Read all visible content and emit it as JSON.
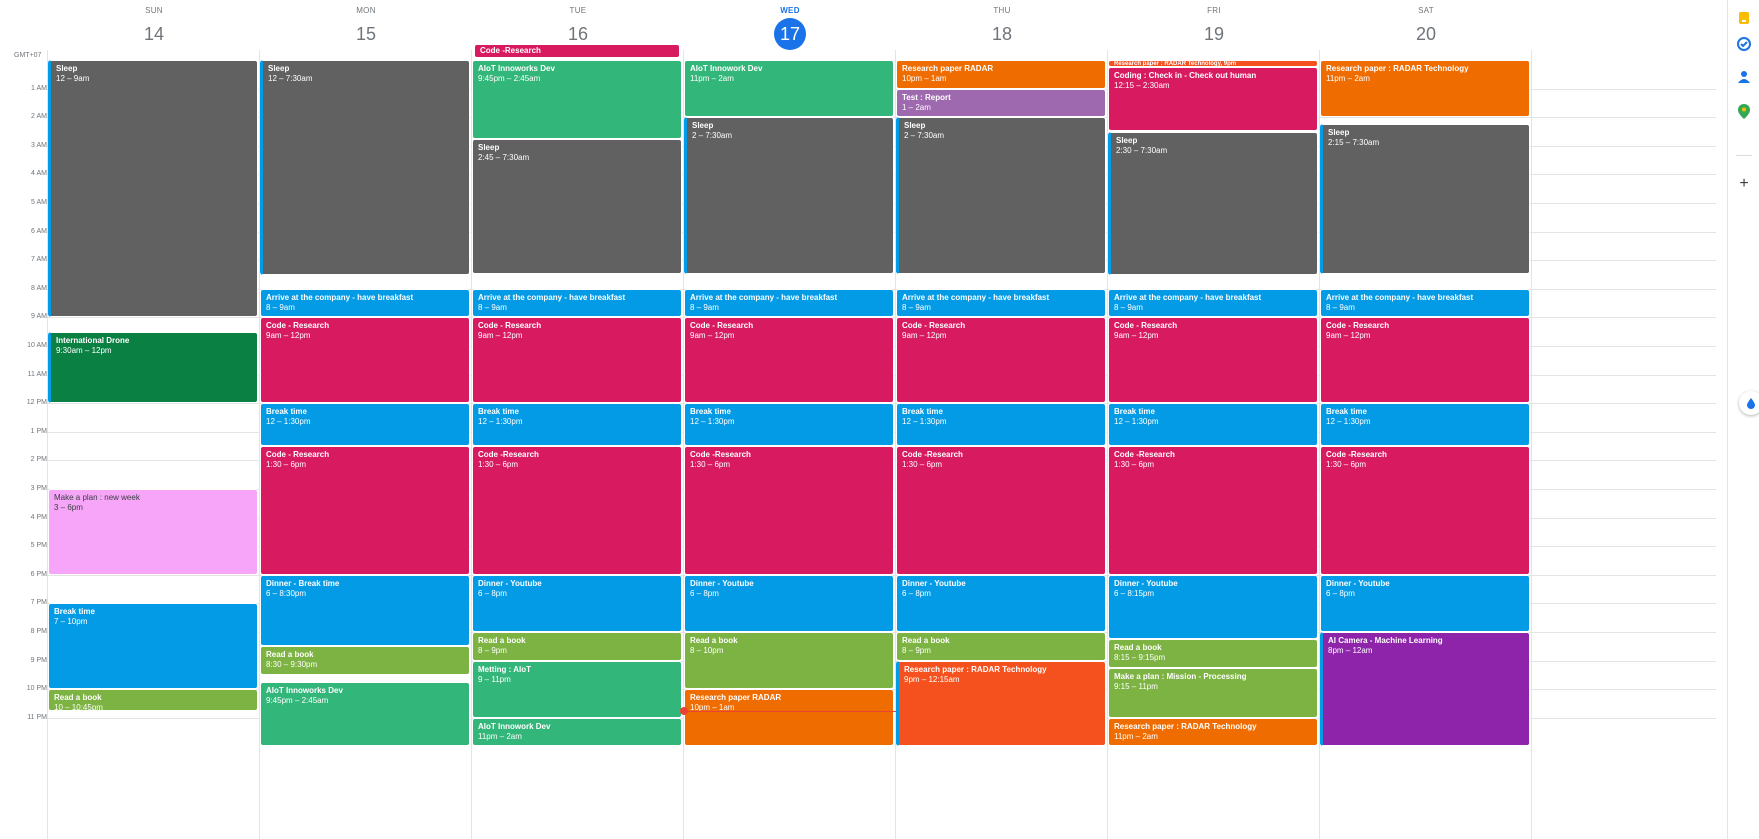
{
  "timezone": "GMT+07",
  "hours": [
    "1 AM",
    "2 AM",
    "3 AM",
    "4 AM",
    "5 AM",
    "6 AM",
    "7 AM",
    "8 AM",
    "9 AM",
    "10 AM",
    "11 AM",
    "12 PM",
    "1 PM",
    "2 PM",
    "3 PM",
    "4 PM",
    "5 PM",
    "6 PM",
    "7 PM",
    "8 PM",
    "9 PM",
    "10 PM",
    "11 PM"
  ],
  "colors": {
    "sleep": "#616161",
    "blue": "#039be5",
    "red": "#d81b60",
    "green": "#33b679",
    "darkgreen": "#0b8043",
    "olive": "#7cb342",
    "orange": "#ef6c00",
    "lavender": "#9e69af",
    "pink": "#f6a5f8",
    "tomato": "#f4511e",
    "purple": "#8e24aa",
    "today": "#1a73e8",
    "now": "#ea4335"
  },
  "days": [
    {
      "dow": "SUN",
      "date": "14",
      "today": false,
      "events": [
        {
          "title": "Sleep",
          "time": "12 – 9am",
          "color": "sleep",
          "start": 0,
          "end": 9,
          "ongoing": true
        },
        {
          "title": "International Drone",
          "time": "9:30am – 12pm",
          "color": "darkgreen",
          "start": 9.5,
          "end": 12,
          "ongoing": true
        },
        {
          "title": "Make a plan : new week",
          "time": "3 – 6pm",
          "color": "pink",
          "start": 15,
          "end": 18,
          "dark": true
        },
        {
          "title": "Break time",
          "time": "7 – 10pm",
          "color": "blue",
          "start": 19,
          "end": 22
        },
        {
          "title": "Read a book",
          "time": "10 – 10:45pm",
          "color": "olive",
          "start": 22,
          "end": 22.75
        }
      ]
    },
    {
      "dow": "MON",
      "date": "15",
      "today": false,
      "events": [
        {
          "title": "Sleep",
          "time": "12 – 7:30am",
          "color": "sleep",
          "start": 0,
          "end": 7.5,
          "ongoing": true
        },
        {
          "title": "Arrive at the company - have breakfast",
          "time": "8 – 9am",
          "color": "blue",
          "start": 8,
          "end": 9
        },
        {
          "title": "Code - Research",
          "time": "9am – 12pm",
          "color": "red",
          "start": 9,
          "end": 12
        },
        {
          "title": "Break time",
          "time": "12 – 1:30pm",
          "color": "blue",
          "start": 12,
          "end": 13.5
        },
        {
          "title": "Code - Research",
          "time": "1:30 – 6pm",
          "color": "red",
          "start": 13.5,
          "end": 18
        },
        {
          "title": "Dinner - Break time",
          "time": "6 – 8:30pm",
          "color": "blue",
          "start": 18,
          "end": 20.5
        },
        {
          "title": "Read a book",
          "time": "8:30 – 9:30pm",
          "color": "olive",
          "start": 20.5,
          "end": 21.5
        },
        {
          "title": "AIoT Innoworks Dev",
          "time": "9:45pm – 2:45am",
          "color": "green",
          "start": 21.75,
          "end": 24
        }
      ]
    },
    {
      "dow": "TUE",
      "date": "16",
      "today": false,
      "allday": {
        "title": "Code -Research",
        "color": "red"
      },
      "events": [
        {
          "title": "AIoT Innoworks Dev",
          "time": "9:45pm – 2:45am",
          "color": "green",
          "start": 0,
          "end": 2.75
        },
        {
          "title": "Sleep",
          "time": "2:45 – 7:30am",
          "color": "sleep",
          "start": 2.75,
          "end": 7.5
        },
        {
          "title": "Arrive at the company - have breakfast",
          "time": "8 – 9am",
          "color": "blue",
          "start": 8,
          "end": 9
        },
        {
          "title": "Code - Research",
          "time": "9am – 12pm",
          "color": "red",
          "start": 9,
          "end": 12
        },
        {
          "title": "Break time",
          "time": "12 – 1:30pm",
          "color": "blue",
          "start": 12,
          "end": 13.5
        },
        {
          "title": "Code -Research",
          "time": "1:30 – 6pm",
          "color": "red",
          "start": 13.5,
          "end": 18
        },
        {
          "title": "Dinner - Youtube",
          "time": "6 – 8pm",
          "color": "blue",
          "start": 18,
          "end": 20
        },
        {
          "title": "Read a book",
          "time": "8 – 9pm",
          "color": "olive",
          "start": 20,
          "end": 21
        },
        {
          "title": "Metting : AIoT",
          "time": "9 – 11pm",
          "color": "green",
          "start": 21,
          "end": 23
        },
        {
          "title": "AIoT Innowork Dev",
          "time": "11pm – 2am",
          "color": "green",
          "start": 23,
          "end": 24
        }
      ]
    },
    {
      "dow": "WED",
      "date": "17",
      "today": true,
      "events": [
        {
          "title": "AIoT Innowork Dev",
          "time": "11pm – 2am",
          "color": "green",
          "start": 0,
          "end": 2
        },
        {
          "title": "Sleep",
          "time": "2 – 7:30am",
          "color": "sleep",
          "start": 2,
          "end": 7.5,
          "ongoing": true
        },
        {
          "title": "Arrive at the company - have breakfast",
          "time": "8 – 9am",
          "color": "blue",
          "start": 8,
          "end": 9
        },
        {
          "title": "Code - Research",
          "time": "9am – 12pm",
          "color": "red",
          "start": 9,
          "end": 12
        },
        {
          "title": "Break time",
          "time": "12 – 1:30pm",
          "color": "blue",
          "start": 12,
          "end": 13.5
        },
        {
          "title": "Code -Research",
          "time": "1:30 – 6pm",
          "color": "red",
          "start": 13.5,
          "end": 18
        },
        {
          "title": "Dinner - Youtube",
          "time": "6 – 8pm",
          "color": "blue",
          "start": 18,
          "end": 20
        },
        {
          "title": "Read a book",
          "time": "8 – 10pm",
          "color": "olive",
          "start": 20,
          "end": 22
        },
        {
          "title": "Research paper RADAR",
          "time": "10pm – 1am",
          "color": "orange",
          "start": 22,
          "end": 24
        }
      ]
    },
    {
      "dow": "THU",
      "date": "18",
      "today": false,
      "events": [
        {
          "title": "Research paper RADAR",
          "time": "10pm – 1am",
          "color": "orange",
          "start": 0,
          "end": 1
        },
        {
          "title": "Test : Report",
          "time": "1 – 2am",
          "color": "lavender",
          "start": 1,
          "end": 2
        },
        {
          "title": "Sleep",
          "time": "2 – 7:30am",
          "color": "sleep",
          "start": 2,
          "end": 7.5,
          "ongoing": true
        },
        {
          "title": "Arrive at the company - have breakfast",
          "time": "8 – 9am",
          "color": "blue",
          "start": 8,
          "end": 9
        },
        {
          "title": "Code - Research",
          "time": "9am – 12pm",
          "color": "red",
          "start": 9,
          "end": 12
        },
        {
          "title": "Break time",
          "time": "12 – 1:30pm",
          "color": "blue",
          "start": 12,
          "end": 13.5
        },
        {
          "title": "Code -Research",
          "time": "1:30 – 6pm",
          "color": "red",
          "start": 13.5,
          "end": 18
        },
        {
          "title": "Dinner - Youtube",
          "time": "6 – 8pm",
          "color": "blue",
          "start": 18,
          "end": 20
        },
        {
          "title": "Read a book",
          "time": "8 – 9pm",
          "color": "olive",
          "start": 20,
          "end": 21
        },
        {
          "title": "Research paper : RADAR Technology",
          "time": "9pm – 12:15am",
          "color": "tomato",
          "start": 21,
          "end": 24,
          "ongoing": true
        }
      ]
    },
    {
      "dow": "FRI",
      "date": "19",
      "today": false,
      "events": [
        {
          "title": "Research paper : RADAR Technology, 9pm",
          "time": "",
          "color": "tomato",
          "start": 0,
          "end": 0.25,
          "tiny": true
        },
        {
          "title": "Coding : Check in - Check out human",
          "time": "12:15 – 2:30am",
          "color": "red",
          "start": 0.25,
          "end": 2.5
        },
        {
          "title": "Sleep",
          "time": "2:30 – 7:30am",
          "color": "sleep",
          "start": 2.5,
          "end": 7.5,
          "ongoing": true
        },
        {
          "title": "Arrive at the company - have breakfast",
          "time": "8 – 9am",
          "color": "blue",
          "start": 8,
          "end": 9
        },
        {
          "title": "Code - Research",
          "time": "9am – 12pm",
          "color": "red",
          "start": 9,
          "end": 12
        },
        {
          "title": "Break time",
          "time": "12 – 1:30pm",
          "color": "blue",
          "start": 12,
          "end": 13.5
        },
        {
          "title": "Code -Research",
          "time": "1:30 – 6pm",
          "color": "red",
          "start": 13.5,
          "end": 18
        },
        {
          "title": "Dinner - Youtube",
          "time": "6 – 8:15pm",
          "color": "blue",
          "start": 18,
          "end": 20.25
        },
        {
          "title": "Read a book",
          "time": "8:15 – 9:15pm",
          "color": "olive",
          "start": 20.25,
          "end": 21.25
        },
        {
          "title": "Make a plan : Mission - Processing",
          "time": "9:15 – 11pm",
          "color": "olive",
          "start": 21.25,
          "end": 23
        },
        {
          "title": "Research paper : RADAR Technology",
          "time": "11pm – 2am",
          "color": "orange",
          "start": 23,
          "end": 24
        }
      ]
    },
    {
      "dow": "SAT",
      "date": "20",
      "today": false,
      "events": [
        {
          "title": "Research paper : RADAR Technology",
          "time": "11pm – 2am",
          "color": "orange",
          "start": 0,
          "end": 2
        },
        {
          "title": "Sleep",
          "time": "2:15 – 7:30am",
          "color": "sleep",
          "start": 2.25,
          "end": 7.5,
          "ongoing": true
        },
        {
          "title": "Arrive at the company - have breakfast",
          "time": "8 – 9am",
          "color": "blue",
          "start": 8,
          "end": 9
        },
        {
          "title": "Code - Research",
          "time": "9am – 12pm",
          "color": "red",
          "start": 9,
          "end": 12
        },
        {
          "title": "Break time",
          "time": "12 – 1:30pm",
          "color": "blue",
          "start": 12,
          "end": 13.5
        },
        {
          "title": "Code -Research",
          "time": "1:30 – 6pm",
          "color": "red",
          "start": 13.5,
          "end": 18
        },
        {
          "title": "Dinner - Youtube",
          "time": "6 – 8pm",
          "color": "blue",
          "start": 18,
          "end": 20
        },
        {
          "title": "AI Camera - Machine Learning",
          "time": "8pm – 12am",
          "color": "purple",
          "start": 20,
          "end": 24,
          "ongoing": true
        }
      ]
    }
  ],
  "sidebar": [
    "keep-icon",
    "tasks-icon",
    "contacts-icon",
    "maps-icon",
    "add-icon"
  ]
}
